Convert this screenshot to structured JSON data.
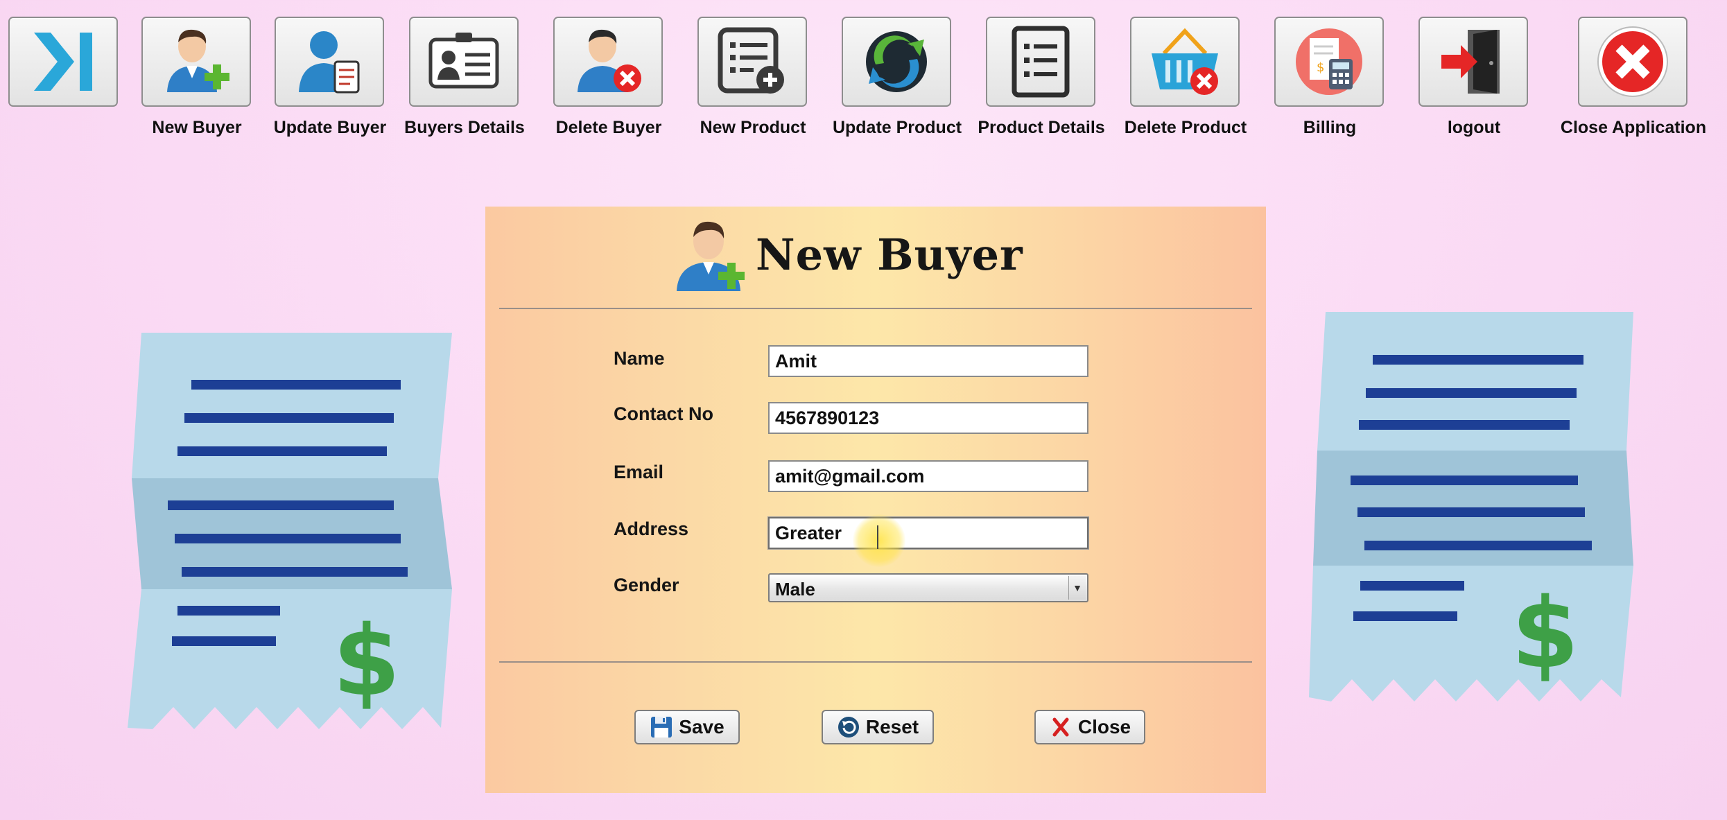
{
  "toolbar": {
    "items": [
      {
        "label": "",
        "icon": "collapse-sidebar-icon"
      },
      {
        "label": "New Buyer",
        "icon": "add-user-icon"
      },
      {
        "label": "Update Buyer",
        "icon": "update-user-icon"
      },
      {
        "label": "Buyers Details",
        "icon": "id-card-icon"
      },
      {
        "label": "Delete Buyer",
        "icon": "delete-user-icon"
      },
      {
        "label": "New Product",
        "icon": "add-list-icon"
      },
      {
        "label": "Update Product",
        "icon": "refresh-icon"
      },
      {
        "label": "Product Details",
        "icon": "list-icon"
      },
      {
        "label": "Delete Product",
        "icon": "delete-basket-icon"
      },
      {
        "label": "Billing",
        "icon": "billing-icon"
      },
      {
        "label": "logout",
        "icon": "logout-icon"
      },
      {
        "label": "Close Application",
        "icon": "close-circle-icon"
      }
    ]
  },
  "dialog": {
    "title": "New Buyer",
    "fields": {
      "name": {
        "label": "Name",
        "value": "Amit"
      },
      "contact": {
        "label": "Contact No",
        "value": "4567890123"
      },
      "email": {
        "label": "Email",
        "value": "amit@gmail.com"
      },
      "address": {
        "label": "Address",
        "value": "Greater "
      },
      "gender": {
        "label": "Gender",
        "value": "Male"
      }
    },
    "buttons": {
      "save": "Save",
      "reset": "Reset",
      "close": "Close"
    }
  },
  "colors": {
    "accent_blue": "#1d3f95",
    "receipt_light": "#b7d9ea",
    "receipt_dark": "#9ec4d9",
    "dollar_green": "#3ea047",
    "close_red": "#e52626"
  }
}
